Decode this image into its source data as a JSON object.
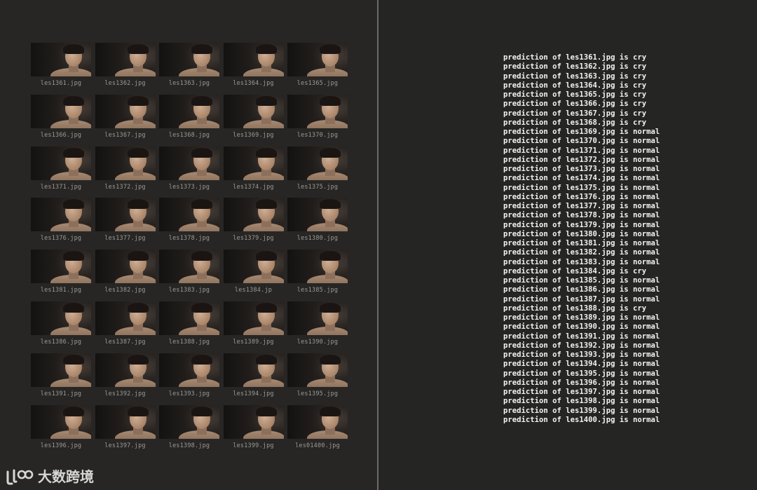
{
  "thumbnails": [
    {
      "label": "les1361.jpg"
    },
    {
      "label": "les1362.jpg"
    },
    {
      "label": "les1363.jpg"
    },
    {
      "label": "les1364.jpg"
    },
    {
      "label": "les1365.jpg"
    },
    {
      "label": "les1366.jpg"
    },
    {
      "label": "les1367.jpg"
    },
    {
      "label": "les1368.jpg"
    },
    {
      "label": "les1369.jpg"
    },
    {
      "label": "les1370.jpg"
    },
    {
      "label": "les1371.jpg"
    },
    {
      "label": "les1372.jpg"
    },
    {
      "label": "les1373.jpg"
    },
    {
      "label": "les1374.jpg"
    },
    {
      "label": "les1375.jpg"
    },
    {
      "label": "les1376.jpg"
    },
    {
      "label": "les1377.jpg"
    },
    {
      "label": "les1378.jpg"
    },
    {
      "label": "les1379.jpg"
    },
    {
      "label": "les1380.jpg"
    },
    {
      "label": "les1381.jpg"
    },
    {
      "label": "les1382.jpg"
    },
    {
      "label": "les1383.jpg"
    },
    {
      "label": "les1384.jp"
    },
    {
      "label": "les1385.jpg"
    },
    {
      "label": "les1386.jpg"
    },
    {
      "label": "les1387.jpg"
    },
    {
      "label": "les1388.jpg"
    },
    {
      "label": "les1389.jpg"
    },
    {
      "label": "les1390.jpg"
    },
    {
      "label": "les1391.jpg"
    },
    {
      "label": "les1392.jpg"
    },
    {
      "label": "les1393.jpg"
    },
    {
      "label": "les1394.jpg"
    },
    {
      "label": "les1395.jpg"
    },
    {
      "label": "les1396.jpg"
    },
    {
      "label": "les1397.jpg"
    },
    {
      "label": "les1398.jpg"
    },
    {
      "label": "les1399.jpg"
    },
    {
      "label": "les01400.jpg"
    }
  ],
  "output_lines": [
    "prediction of les1361.jpg is cry",
    "prediction of les1362.jpg is cry",
    "prediction of les1363.jpg is cry",
    "prediction of les1364.jpg is cry",
    "prediction of les1365.jpg is cry",
    "prediction of les1366.jpg is cry",
    "prediction of les1367.jpg is cry",
    "prediction of les1368.jpg is cry",
    "prediction of les1369.jpg is normal",
    "prediction of les1370.jpg is normal",
    "prediction of les1371.jpg is normal",
    "prediction of les1372.jpg is normal",
    "prediction of les1373.jpg is normal",
    "prediction of les1374.jpg is normal",
    "prediction of les1375.jpg is normal",
    "prediction of les1376.jpg is normal",
    "prediction of les1377.jpg is normal",
    "prediction of les1378.jpg is normal",
    "prediction of les1379.jpg is normal",
    "prediction of les1380.jpg is normal",
    "prediction of les1381.jpg is normal",
    "prediction of les1382.jpg is normal",
    "prediction of les1383.jpg is normal",
    "prediction of les1384.jpg is cry",
    "prediction of les1385.jpg is normal",
    "prediction of les1386.jpg is normal",
    "prediction of les1387.jpg is normal",
    "prediction of les1388.jpg is cry",
    "prediction of les1389.jpg is normal",
    "prediction of les1390.jpg is normal",
    "prediction of les1391.jpg is normal",
    "prediction of les1392.jpg is normal",
    "prediction of les1393.jpg is normal",
    "prediction of les1394.jpg is normal",
    "prediction of les1395.jpg is normal",
    "prediction of les1396.jpg is normal",
    "prediction of les1397.jpg is normal",
    "prediction of les1398.jpg is normal",
    "prediction of les1399.jpg is normal",
    "prediction of les1400.jpg is normal"
  ],
  "watermark": {
    "text": "大数跨境",
    "icon": "brand-logo-icon"
  },
  "colors": {
    "left_background": "#272624",
    "right_background": "#252523",
    "divider": "#6b6b6b",
    "output_text": "#f2f2f2",
    "label_text": "#9a9a96"
  }
}
